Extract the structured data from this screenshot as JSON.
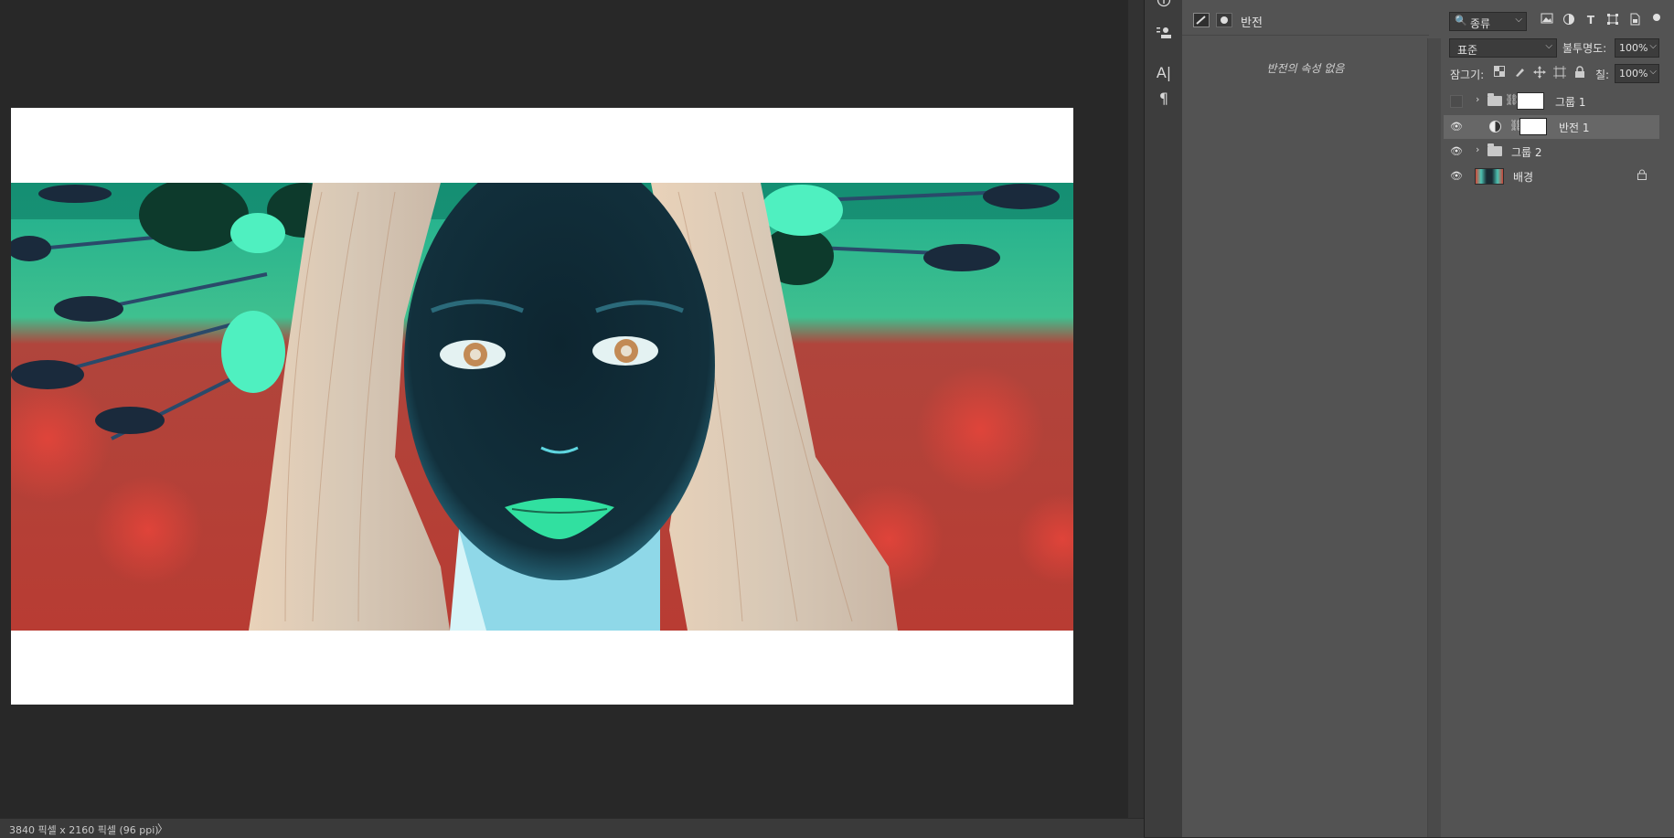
{
  "status_bar": {
    "doc_info": "3840 픽셀 x 2160 픽셀 (96 ppi)",
    "arrow": "〉"
  },
  "icon_column": {
    "icons": [
      "info-icon",
      "glyph-panel-icon",
      "character-icon",
      "paragraph-icon"
    ],
    "character_glyph": "A|",
    "paragraph_glyph": "¶"
  },
  "properties": {
    "title": "반전",
    "message": "반전의 속성 없음"
  },
  "layers_panel": {
    "filter_kind": "종류",
    "blend_mode": "표준",
    "opacity_label": "불투명도:",
    "opacity_value": "100%",
    "lock_label": "잠그기:",
    "fill_label": "칠:",
    "fill_value": "100%",
    "filter_icons": [
      "image-filter-icon",
      "adjustment-filter-icon",
      "type-filter-icon",
      "shape-filter-icon",
      "smart-object-filter-icon"
    ],
    "layers": [
      {
        "name": "그룹 1",
        "type": "group",
        "visible": false,
        "has_mask": true
      },
      {
        "name": "반전 1",
        "type": "adjustment",
        "visible": true,
        "has_mask": true,
        "selected": true
      },
      {
        "name": "그룹 2",
        "type": "group",
        "visible": true,
        "has_mask": false
      },
      {
        "name": "배경",
        "type": "background",
        "visible": true,
        "locked": true
      }
    ]
  },
  "colors": {
    "app_bg": "#282828",
    "panel_bg": "#535353",
    "selected_layer": "#676767"
  }
}
